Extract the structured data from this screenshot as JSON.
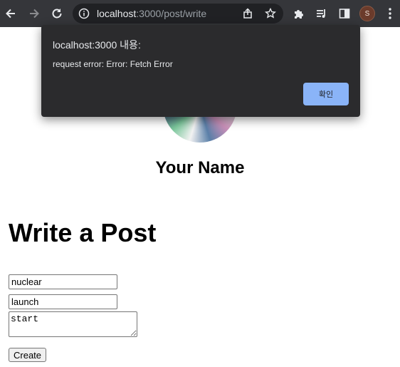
{
  "browser": {
    "url_host": "localhost",
    "url_path": ":3000/post/write",
    "profile_initial": "S",
    "icons": [
      "back-arrow-icon",
      "forward-arrow-icon",
      "reload-icon",
      "info-icon",
      "share-icon",
      "star-icon",
      "puzzle-icon",
      "media-queue-icon",
      "side-panel-icon",
      "kebab-menu-icon"
    ]
  },
  "profile": {
    "name": "Your Name"
  },
  "page": {
    "title": "Write a Post",
    "form": {
      "field1_value": "nuclear",
      "field2_value": "launch",
      "textarea_value": "start",
      "submit_label": "Create"
    }
  },
  "dialog": {
    "title": "localhost:3000 내용:",
    "message": "request error: Error: Fetch Error",
    "ok_label": "확인",
    "button_color": "#8ab4f8"
  }
}
